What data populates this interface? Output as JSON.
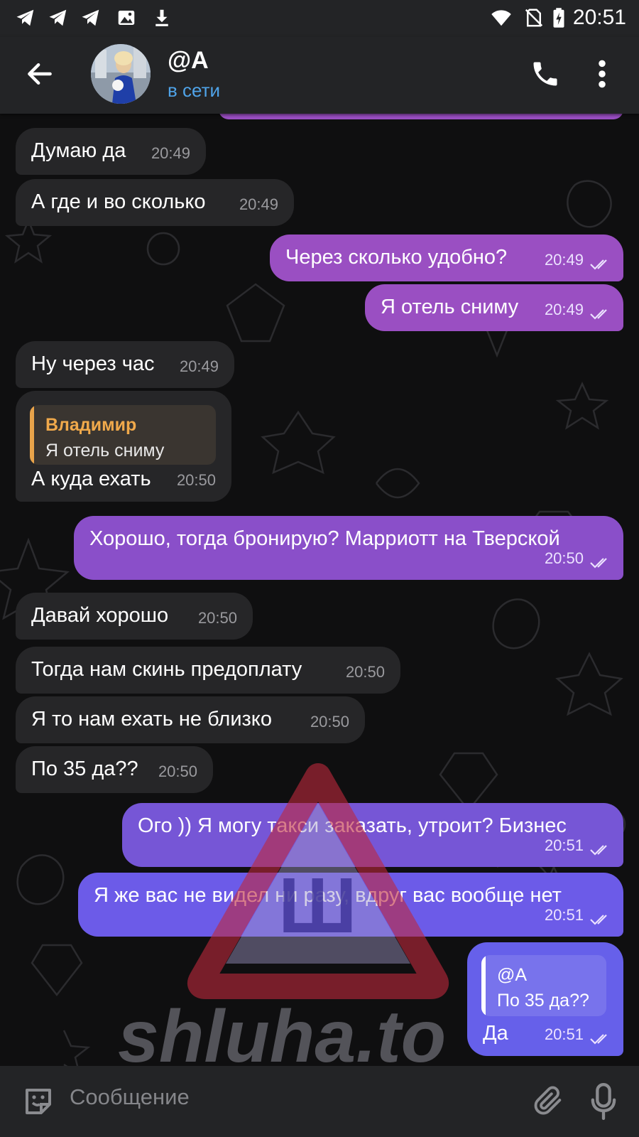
{
  "status_bar": {
    "time": "20:51",
    "left_icons": [
      "telegram-icon",
      "telegram-icon",
      "telegram-icon",
      "image-icon",
      "download-icon"
    ],
    "right_icons": [
      "wifi-icon",
      "no-sim-icon",
      "battery-charging-icon"
    ]
  },
  "header": {
    "contact_name": "@A",
    "contact_status": "в сети",
    "icons": [
      "back-arrow-icon",
      "phone-icon",
      "more-vertical-icon"
    ]
  },
  "messages": [
    {
      "dir": "in",
      "text": "Думаю да",
      "time": "20:49"
    },
    {
      "dir": "in",
      "text": "А где и во сколько",
      "time": "20:49"
    },
    {
      "dir": "out",
      "text": "Через сколько удобно?",
      "time": "20:49",
      "read": true
    },
    {
      "dir": "out",
      "text": "Я отель сниму",
      "time": "20:49",
      "read": true
    },
    {
      "dir": "in",
      "text": "Ну через час",
      "time": "20:49"
    },
    {
      "dir": "in",
      "reply_name": "Владимир",
      "reply_text": "Я отель сниму",
      "text": "А куда ехать",
      "time": "20:50"
    },
    {
      "dir": "out",
      "text": "Хорошо, тогда бронирую? Марриотт на Тверской",
      "time": "20:50",
      "read": true
    },
    {
      "dir": "in",
      "text": "Давай хорошо",
      "time": "20:50"
    },
    {
      "dir": "in",
      "text": "Тогда нам скинь предоплату",
      "time": "20:50"
    },
    {
      "dir": "in",
      "text": "Я то нам ехать не близко",
      "time": "20:50"
    },
    {
      "dir": "in",
      "text": "По 35 да??",
      "time": "20:50"
    },
    {
      "dir": "out",
      "text": "Ого )) Я могу такси заказать, утроит? Бизнес",
      "time": "20:51",
      "read": true
    },
    {
      "dir": "out",
      "text": "Я же вас не видел ни разу, вдруг вас вообще нет",
      "time": "20:51",
      "read": true
    },
    {
      "dir": "out",
      "reply_name": "@A",
      "reply_text": "По 35 да??",
      "text": "Да",
      "time": "20:51",
      "read": true
    }
  ],
  "watermark": {
    "text": "shluha.to",
    "letter": "Ш"
  },
  "composer": {
    "placeholder": "Сообщение",
    "icons": [
      "sticker-icon",
      "paperclip-icon",
      "microphone-icon"
    ]
  },
  "colors": {
    "bar_bg": "#232426",
    "chat_bg": "#0f0f10",
    "incoming": "#262628",
    "outgoing_top": "#9a4fc2",
    "outgoing_bottom": "#6c5be8",
    "online": "#4fa3e8",
    "reply_accent": "#f0a94b"
  }
}
